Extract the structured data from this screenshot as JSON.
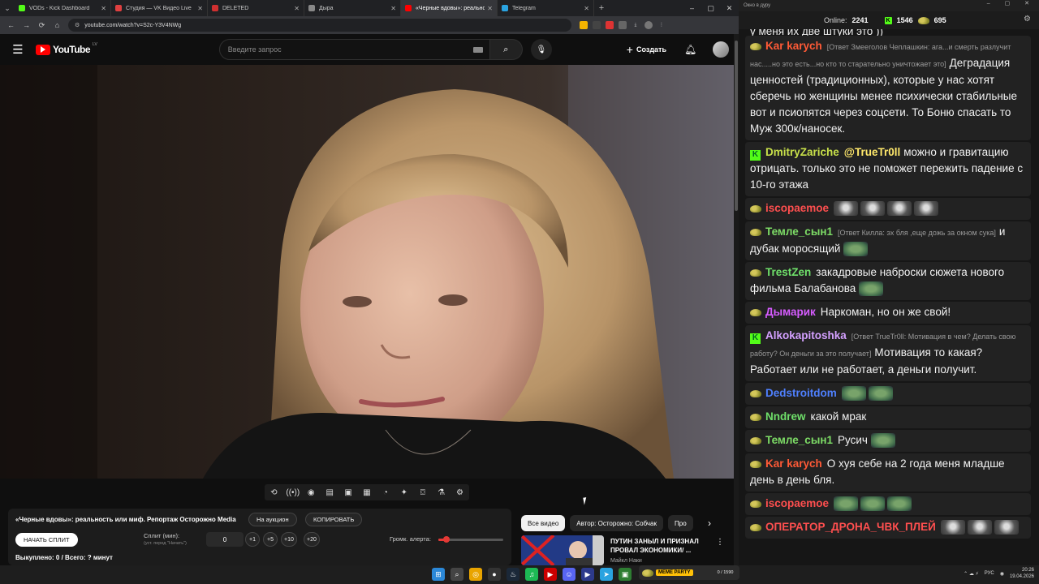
{
  "tabs": [
    {
      "label": "VODs - Kick Dashboard",
      "color": "#53fc18"
    },
    {
      "label": "Студия — VK Видео Live",
      "color": "#e04040"
    },
    {
      "label": "DELETED",
      "color": "#d03030"
    },
    {
      "label": "Дыра",
      "color": "#888888"
    },
    {
      "label": "«Черные вдовы»: реально",
      "color": "#ff0000"
    },
    {
      "label": "Telegram",
      "color": "#2aa3e0"
    }
  ],
  "address": {
    "url": "youtube.com/watch?v=S2c-Y3V4NWg"
  },
  "youtube": {
    "logo": "YouTube",
    "country": "LV",
    "search_placeholder": "Введите запрос",
    "create_label": "Создать"
  },
  "toolbar_icons": [
    "repeat-icon",
    "live-icon",
    "camera-eye-icon",
    "clapper-icon",
    "frame-icon",
    "film-icon",
    "speed-icon",
    "ai-icon",
    "screenshot-icon",
    "lab-icon",
    "settings-icon"
  ],
  "panel": {
    "video_title": "«Черные вдовы»: реальность или миф. Репортаж Осторожно Media",
    "auction_button": "На аукцион",
    "copy_button": "КОПИРОВАТЬ",
    "start_split_button": "НАЧАТЬ СПЛИТ",
    "split_label": "Сплит (мин):",
    "split_hint": "(уст. перед \"Начать\")",
    "split_value": "0",
    "increments": [
      "+1",
      "+5",
      "+10",
      "+20"
    ],
    "alert_volume_label": "Громк. алерта:",
    "alert_volume": 0.12,
    "bought_text": "Выкуплено: 0 / Всего: ? минут"
  },
  "chips": [
    "Все видео",
    "Автор: Осторожно: Собчак",
    "Про"
  ],
  "recommendation": {
    "title": "ПУТИН ЗАНЫЛ И ПРИЗНАЛ ПРОВАЛ ЭКОНОМИКИ/ ...",
    "channel": "Майкл Наки"
  },
  "chat": {
    "window_title": "Окно в дуру",
    "online_label": "Online:",
    "online_count": "2241",
    "kick_count": "1546",
    "vk_count": "695",
    "top_partial": "у меня их две штуки это ))",
    "messages": [
      {
        "platform": "vk",
        "user": "Kar karych",
        "color": "#ff5a36",
        "reply": "[Ответ Змееголов Чеплашкин: ага...и смерть разлучит нас.....но это есть...но кто то старательно уничтожает это]",
        "text": "Деградация ценностей (традиционных), которые у нас хотят сберечь но женщины менее психически стабильные вот и псиопятся через соцсети. То Боню спасать то Муж 300к/наносек.",
        "emotes": 0
      },
      {
        "platform": "kick",
        "user": "DmitryZariche",
        "color": "#c8e04a",
        "mention": "@TrueTr0ll",
        "reply": "",
        "text": "можно и гравитацию отрицать. только это не поможет пережить падение с 10-го этажа",
        "emotes": 0
      },
      {
        "platform": "vk",
        "user": "iscopaemoe",
        "color": "#ff4f4f",
        "reply": "",
        "text": "",
        "emotes": 4,
        "emote_kind": "grey"
      },
      {
        "platform": "vk",
        "user": "Темле_сын1",
        "color": "#7ddc66",
        "reply": "[Ответ Килла: эх бля ,еще дожь за окном сука]",
        "text": "и дубак моросящий",
        "emotes": 1,
        "emote_kind": "frog"
      },
      {
        "platform": "vk",
        "user": "TrestZen",
        "color": "#6fe06a",
        "reply": "",
        "text": "закадровые наброски сюжета нового фильма Балабанова",
        "emotes": 1,
        "emote_kind": "frog"
      },
      {
        "platform": "vk",
        "user": "Дымарик",
        "color": "#d65cff",
        "reply": "",
        "text": "Наркоман, но он же свой!",
        "emotes": 0
      },
      {
        "platform": "kick",
        "user": "Alkokapitoshka",
        "color": "#d4a0ff",
        "reply": "[Ответ TrueTr0ll: Мотивация в чем? Делать свою работу? Он деньги за это получает]",
        "text": "Мотивация то какая? Работает или не работает, а деньги получит.",
        "emotes": 0
      },
      {
        "platform": "vk",
        "user": "Dedstroitdom",
        "color": "#4f80ff",
        "reply": "",
        "text": "",
        "emotes": 2,
        "emote_kind": "frog"
      },
      {
        "platform": "vk",
        "user": "Nndrew",
        "color": "#6fe06a",
        "reply": "",
        "text": "какой мрак",
        "emotes": 0
      },
      {
        "platform": "vk",
        "user": "Темле_сын1",
        "color": "#7ddc66",
        "reply": "",
        "text": "Русич",
        "emotes": 1,
        "emote_kind": "frog"
      },
      {
        "platform": "vk",
        "user": "Kar karych",
        "color": "#ff5a36",
        "reply": "",
        "text": "О хуя себе на 2 года меня младше день в день бля.",
        "emotes": 0
      },
      {
        "platform": "vk",
        "user": "iscopaemoe",
        "color": "#ff4f4f",
        "reply": "",
        "text": "",
        "emotes": 3,
        "emote_kind": "frog"
      },
      {
        "platform": "vk",
        "user": "ОПЕРАТОР_ДРОНА_ЧВК_ПЛЕЙ",
        "color": "#ff4f4f",
        "reply": "",
        "text": "",
        "emotes": 3,
        "emote_kind": "grey"
      }
    ]
  },
  "memebar": {
    "label": "MEME PARTY",
    "count": "0 / 1590"
  },
  "taskbar": {
    "icons": [
      "windows-icon",
      "search-icon",
      "chrome-icon",
      "obs-icon",
      "steam-icon",
      "spotify-icon",
      "youtube-music-icon",
      "discord-icon",
      "media-player-icon",
      "telegram-icon",
      "files-icon"
    ],
    "lang": "РУС",
    "time": "20:26",
    "date": "19.04.2026"
  }
}
